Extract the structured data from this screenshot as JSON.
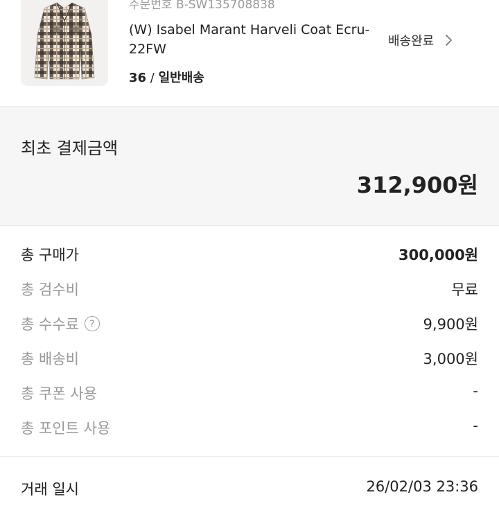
{
  "product": {
    "order_number": "주문번호 B-SW135708838",
    "name": "(W) Isabel Marant Harveli Coat Ecru- 22FW",
    "size": "36",
    "option_sep": " / ",
    "shipping_type": "일반배송",
    "status": "배송완료",
    "status_icon": "chevron-right-icon"
  },
  "payment": {
    "title": "최초 결제금액",
    "amount": "312,900원"
  },
  "breakdown": [
    {
      "label": "총 구매가",
      "value": "300,000원"
    },
    {
      "label": "총 검수비",
      "value": "무료"
    },
    {
      "label": "총 수수료",
      "value": "9,900원",
      "help_glyph": "?"
    },
    {
      "label": "총 배송비",
      "value": "3,000원"
    },
    {
      "label": "총 쿠폰 사용",
      "value": "-"
    },
    {
      "label": "총 포인트 사용",
      "value": "-"
    }
  ],
  "transaction": {
    "label": "거래 일시",
    "value": "26/02/03 23:36"
  },
  "colors": {
    "text": "#222222",
    "muted": "#9a9a9a",
    "panel": "#f6f6f6",
    "divider": "#ececec"
  }
}
